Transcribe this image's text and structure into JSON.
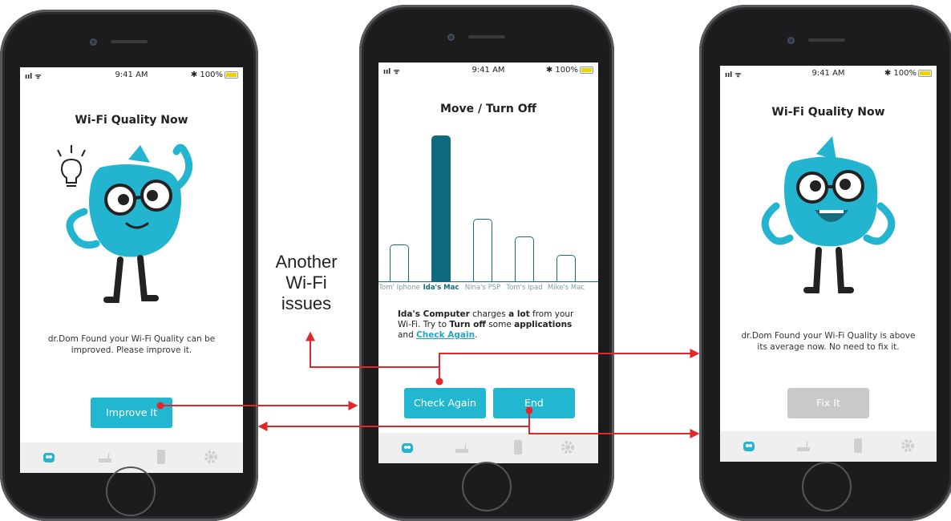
{
  "status_bar": {
    "signal": "ııl ᯤ",
    "time": "9:41 AM",
    "bluetooth": "✱",
    "battery": "100%"
  },
  "screen1": {
    "title": "Wi-Fi Quality Now",
    "message": "dr.Dom Found your Wi-Fi Quality can be improved. Please improve it.",
    "button": "Improve It"
  },
  "screen2": {
    "title": "Move / Turn Off",
    "description": {
      "p1": "Ida's Computer",
      "p2": " charges ",
      "p3": "a lot",
      "p4": " from your Wi-Fi. Try to ",
      "p5": "Turn off",
      "p6": " some ",
      "p7": "applications",
      "p8": " and ",
      "link": "Check Again",
      "p9": "."
    },
    "check_again_button": "Check Again",
    "end_button": "End"
  },
  "screen3": {
    "title": "Wi-Fi Quality Now",
    "message": "dr.Dom Found your Wi-Fi Quality is above its average now. No need to fix it.",
    "button": "Fix It"
  },
  "annotation": {
    "line1": "Another",
    "line2": "Wi-Fi",
    "line3": "issues"
  },
  "chart_data": {
    "type": "bar",
    "title": "",
    "categories": [
      "Tom' Iphone",
      "Ida's Mac",
      "Nina's PSP",
      "Tom's Ipad",
      "Mike's Mac"
    ],
    "values": [
      25,
      100,
      43,
      31,
      18
    ],
    "highlight": "Ida's Mac",
    "xlabel": "",
    "ylabel": "",
    "ylim": [
      0,
      100
    ],
    "grid": false,
    "colors": {
      "highlight": "#0e6b7f",
      "outline": "#1a6a7e"
    }
  },
  "tabs": [
    "robot-icon",
    "router-icon",
    "phone-icon",
    "gear-icon"
  ],
  "colors": {
    "accent": "#21b7d0",
    "arrow": "#e0282a",
    "disabled": "#c9c9cb"
  }
}
